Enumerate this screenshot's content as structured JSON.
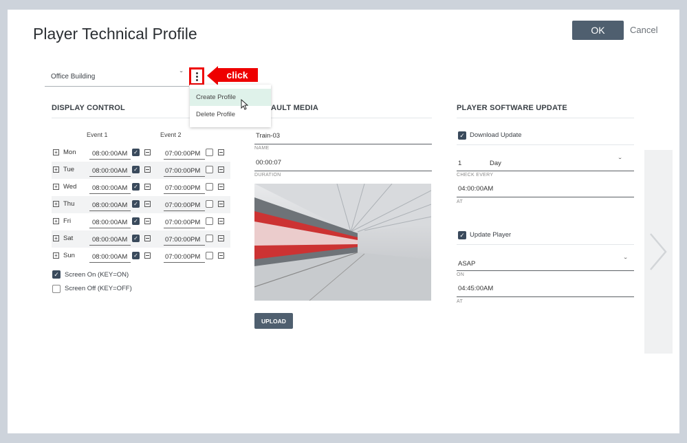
{
  "dialog": {
    "title": "Player Technical Profile",
    "ok_label": "OK",
    "cancel_label": "Cancel"
  },
  "profile": {
    "selected": "Office Building",
    "menu": [
      "Create Profile",
      "Delete Profile"
    ],
    "callout": "click"
  },
  "display_control": {
    "title": "DISPLAY CONTROL",
    "event1_label": "Event 1",
    "event2_label": "Event 2",
    "rows": [
      {
        "day": "Mon",
        "t1": "08:00:00AM",
        "t2": "07:00:00PM"
      },
      {
        "day": "Tue",
        "t1": "08:00:00AM",
        "t2": "07:00:00PM"
      },
      {
        "day": "Wed",
        "t1": "08:00:00AM",
        "t2": "07:00:00PM"
      },
      {
        "day": "Thu",
        "t1": "08:00:00AM",
        "t2": "07:00:00PM"
      },
      {
        "day": "Fri",
        "t1": "08:00:00AM",
        "t2": "07:00:00PM"
      },
      {
        "day": "Sat",
        "t1": "08:00:00AM",
        "t2": "07:00:00PM"
      },
      {
        "day": "Sun",
        "t1": "08:00:00AM",
        "t2": "07:00:00PM"
      }
    ],
    "screen_on": "Screen On (KEY=ON)",
    "screen_off": "Screen Off (KEY=OFF)"
  },
  "default_media": {
    "title": "AULT MEDIA",
    "name_value": "Train-03",
    "name_caption": "NAME",
    "duration_value": "00:00:07",
    "duration_caption": "DURATION",
    "upload_label": "UPLOAD"
  },
  "software_update": {
    "title": "PLAYER SOFTWARE UPDATE",
    "download_label": "Download Update",
    "check_num": "1",
    "check_unit": "Day",
    "check_caption": "CHECK EVERY",
    "at_value": "04:00:00AM",
    "at_caption": "AT",
    "update_player_label": "Update Player",
    "on_value": "ASAP",
    "on_caption": "ON",
    "at2_value": "04:45:00AM",
    "at2_caption": "AT"
  },
  "colors": {
    "accent": "#4f5f6f",
    "callout": "#e00000",
    "menu_highlight": "#dff2ea"
  }
}
